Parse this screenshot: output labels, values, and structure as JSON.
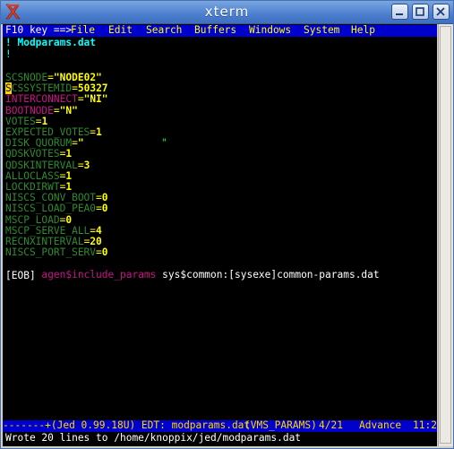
{
  "window": {
    "title": "xterm"
  },
  "menubar": {
    "f10_hint": "F10 key ==>",
    "items": [
      "File",
      "Edit",
      "Search",
      "Buffers",
      "Windows",
      "System",
      "Help"
    ]
  },
  "buffer": {
    "header": "! Modparams.dat",
    "bang": "!",
    "lines": [
      {
        "key": "SCSNODE",
        "eq": "=",
        "val": "\"NODE02\""
      },
      {
        "key": "SCSSYSTEMID",
        "eq": "=",
        "val": "50327"
      },
      {
        "key": "INTERCONNECT",
        "eq": "=",
        "val": "\"NI\""
      },
      {
        "key": "BOOTNODE",
        "eq": "=",
        "val": "\"N\""
      },
      {
        "key": "VOTES",
        "eq": "=",
        "val": "1"
      },
      {
        "key": "EXPECTED_VOTES",
        "eq": "=",
        "val": "1"
      },
      {
        "key": "DISK_QUORUM",
        "eq": "=",
        "val": "\"",
        "tail": "\""
      },
      {
        "key": "QDSKVOTES",
        "eq": "=",
        "val": "1"
      },
      {
        "key": "QDSKINTERVAL",
        "eq": "=",
        "val": "3"
      },
      {
        "key": "ALLOCLASS",
        "eq": "=",
        "val": "1"
      },
      {
        "key": "LOCKDIRWT",
        "eq": "=",
        "val": "1"
      },
      {
        "key": "NISCS_CONV_BOOT",
        "eq": "=",
        "val": "0"
      },
      {
        "key": "NISCS_LOAD_PEA0",
        "eq": "=",
        "val": "0"
      },
      {
        "key": "MSCP_LOAD",
        "eq": "=",
        "val": "0"
      },
      {
        "key": "MSCP_SERVE_ALL",
        "eq": "=",
        "val": "4"
      },
      {
        "key": "RECNXINTERVAL",
        "eq": "=",
        "val": "20"
      },
      {
        "key": "NISCS_PORT_SERV",
        "eq": "=",
        "val": "0"
      }
    ],
    "include_directive": "agen$include_params",
    "include_path": "sys$common:[sysexe]common-params.dat",
    "eob": "[EOB]"
  },
  "status": {
    "left": "-------+(Jed 0.99.18U) EDT: modparams.dat",
    "mode": "(VMS_PARAMS)",
    "pos": "4/21",
    "advance": "Advance",
    "time": "11:2"
  },
  "minibuffer": "Wrote 20 lines to /home/knoppix/jed/modparams.dat",
  "colors": {
    "key": "#2e8b2e",
    "value": "#ffff00",
    "string_key": "#c71585",
    "menu_bg": "#0000cd",
    "menu_fg": "#ffff00",
    "comment": "#00ffff",
    "include": "#c71585",
    "text": "#ffffff"
  }
}
